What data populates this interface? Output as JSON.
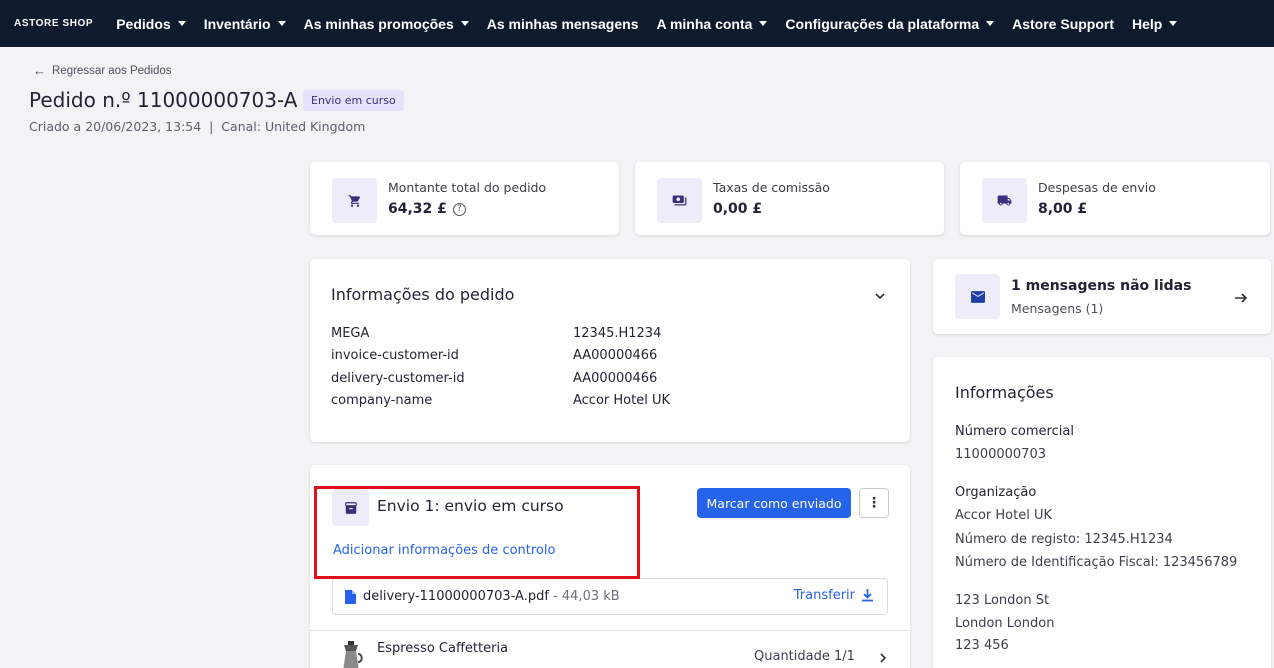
{
  "nav": {
    "logo": "ASTORE SHOP",
    "items": [
      {
        "label": "Pedidos",
        "dropdown": true
      },
      {
        "label": "Inventário",
        "dropdown": true
      },
      {
        "label": "As minhas promoções",
        "dropdown": true
      },
      {
        "label": "As minhas mensagens",
        "dropdown": false
      },
      {
        "label": "A minha conta",
        "dropdown": true
      },
      {
        "label": "Configurações da plataforma",
        "dropdown": true
      },
      {
        "label": "Astore Support",
        "dropdown": false
      },
      {
        "label": "Help",
        "dropdown": true
      }
    ]
  },
  "header": {
    "back_label": "Regressar aos Pedidos",
    "title": "Pedido n.º 11000000703-A",
    "status": "Envio em curso",
    "meta": "Criado a 20/06/2023, 13:54  |  Canal: United Kingdom"
  },
  "stats": [
    {
      "label": "Montante total do pedido",
      "value": "64,32 £",
      "icon": "cart-icon",
      "help": true
    },
    {
      "label": "Taxas de comissão",
      "value": "0,00 £",
      "icon": "cash-icon",
      "help": false
    },
    {
      "label": "Despesas de envio",
      "value": "8,00 £",
      "icon": "truck-icon",
      "help": false
    }
  ],
  "order_info": {
    "title": "Informações do pedido",
    "rows": [
      {
        "key": "MEGA",
        "value": "12345.H1234"
      },
      {
        "key": "invoice-customer-id",
        "value": "AA00000466"
      },
      {
        "key": "delivery-customer-id",
        "value": "AA00000466"
      },
      {
        "key": "company-name",
        "value": "Accor Hotel UK"
      }
    ]
  },
  "shipment": {
    "title": "Envio 1: envio em curso",
    "mark_shipped_label": "Marcar como enviado",
    "add_tracking_label": "Adicionar informações de controlo",
    "file_name": "delivery-11000000703-A.pdf",
    "file_size": " - 44,03 kB",
    "download_label": "Transferir",
    "product_name": "Espresso Caffetteria",
    "quantity": "Quantidade 1/1"
  },
  "messages": {
    "title": "1 mensagens não lidas",
    "subtitle": "Mensagens (1)"
  },
  "info": {
    "title": "Informações",
    "commercial_label": "Número comercial",
    "commercial_value": "11000000703",
    "org_label": "Organização",
    "org_name": "Accor Hotel UK",
    "registration": "Número de registo: 12345.H1234",
    "tax_id": "Número de Identificação Fiscal: 123456789",
    "address_line1": "123 London St",
    "address_line2": "London London",
    "address_line3": "123 456"
  },
  "colors": {
    "nav_bg": "#0f1b2d",
    "primary": "#2563eb",
    "badge_bg": "#e6e2fb",
    "highlight": "#e0101a"
  }
}
